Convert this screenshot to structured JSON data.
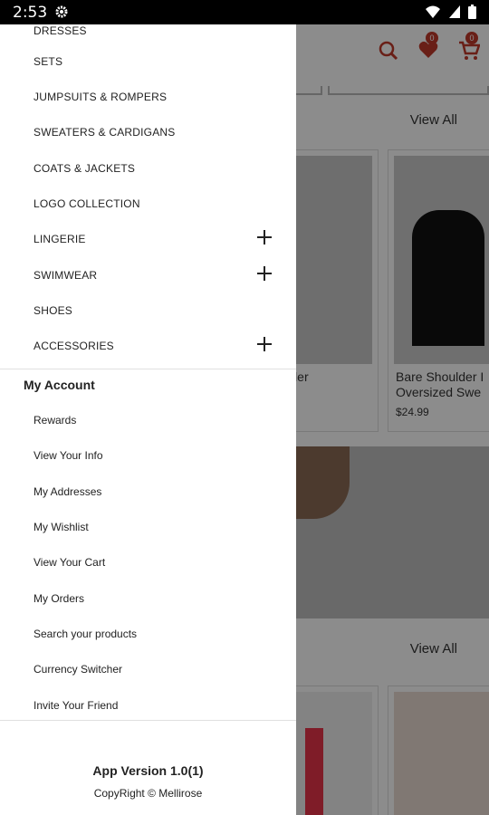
{
  "status_bar": {
    "time": "2:53"
  },
  "background": {
    "wishlist_count": "0",
    "cart_count": "0",
    "view_all_1": "View All",
    "view_all_2": "View All",
    "card1": {
      "title": "et Shoulder\ng"
    },
    "card2": {
      "title": "Bare Shoulder I\nOversized Swe",
      "price": "$24.99"
    }
  },
  "drawer": {
    "top_partial_item": "DRESSES",
    "categories": [
      {
        "label": "SETS",
        "expandable": false
      },
      {
        "label": "JUMPSUITS & ROMPERS",
        "expandable": false
      },
      {
        "label": "SWEATERS & CARDIGANS",
        "expandable": false
      },
      {
        "label": "COATS & JACKETS",
        "expandable": false
      },
      {
        "label": "LOGO COLLECTION",
        "expandable": false
      },
      {
        "label": "LINGERIE",
        "expandable": true
      },
      {
        "label": "SWIMWEAR",
        "expandable": true
      },
      {
        "label": "SHOES",
        "expandable": false
      },
      {
        "label": "ACCESSORIES",
        "expandable": true
      }
    ],
    "account_title": "My Account",
    "account_items": [
      "Rewards",
      "View Your Info",
      "My Addresses",
      "My Wishlist",
      "View Your Cart",
      "My Orders",
      "Search your products",
      "Currency Switcher",
      "Invite Your Friend"
    ],
    "app_version": "App Version 1.0(1)",
    "copyright": "CopyRight © Mellirose"
  },
  "colors": {
    "accent": "#c0392b"
  }
}
